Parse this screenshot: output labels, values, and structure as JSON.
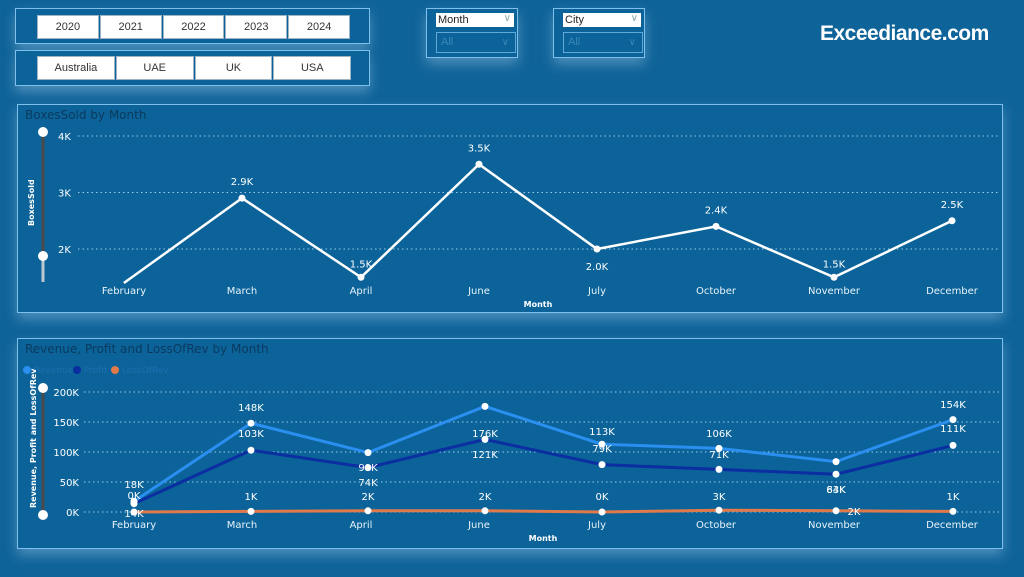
{
  "filters": {
    "years": [
      "2020",
      "2021",
      "2022",
      "2023",
      "2024"
    ],
    "countries": [
      "Australia",
      "UAE",
      "UK",
      "USA"
    ],
    "month_dropdown": {
      "label": "Month",
      "value": "All"
    },
    "city_dropdown": {
      "label": "City",
      "value": "All"
    }
  },
  "brand": "Exceediance.com",
  "colors": {
    "background": "#0e6399",
    "revenue": "#2b8ff0",
    "profit": "#0b2ea0",
    "loss": "#e07a4a",
    "boxes_line": "#ffffff"
  },
  "chart_data": [
    {
      "type": "line",
      "title": "BoxesSold by Month",
      "xlabel": "Month",
      "ylabel": "BoxesSold",
      "categories": [
        "February",
        "March",
        "April",
        "June",
        "July",
        "October",
        "November",
        "December"
      ],
      "series": [
        {
          "name": "BoxesSold",
          "values": [
            1400,
            2900,
            1500,
            3500,
            2000,
            2400,
            1500,
            2500
          ],
          "labels": [
            "",
            "2.9K",
            "1.5K",
            "3.5K",
            "2.0K",
            "2.4K",
            "1.5K",
            "2.5K"
          ]
        }
      ],
      "yticks": [
        "2K",
        "3K",
        "4K"
      ],
      "ylim": [
        1400,
        4000
      ],
      "grid": true
    },
    {
      "type": "line",
      "title": "Revenue, Profit and LossOfRev by Month",
      "xlabel": "Month",
      "ylabel": "Revenue, Profit and LossOfRev",
      "legend": "top-left",
      "categories": [
        "February",
        "March",
        "April",
        "June",
        "July",
        "October",
        "November",
        "December"
      ],
      "series": [
        {
          "name": "Revenue",
          "values": [
            18000,
            148000,
            99000,
            176000,
            113000,
            106000,
            84000,
            154000
          ],
          "labels": [
            "18K",
            "148K",
            "99K",
            "176K",
            "113K",
            "106K",
            "84K",
            "154K"
          ]
        },
        {
          "name": "Profit",
          "values": [
            14000,
            103000,
            74000,
            121000,
            79000,
            71000,
            63000,
            111000
          ],
          "labels": [
            "14K",
            "103K",
            "74K",
            "121K",
            "79K",
            "71K",
            "63K",
            "111K"
          ]
        },
        {
          "name": "LossOfRev",
          "values": [
            0,
            1000,
            2000,
            2000,
            0,
            3000,
            2000,
            1000
          ],
          "labels": [
            "0K",
            "1K",
            "2K",
            "2K",
            "0K",
            "3K",
            "2K",
            "1K"
          ]
        }
      ],
      "yticks": [
        "0K",
        "50K",
        "100K",
        "150K",
        "200K"
      ],
      "ylim": [
        0,
        200000
      ],
      "grid": true
    }
  ]
}
